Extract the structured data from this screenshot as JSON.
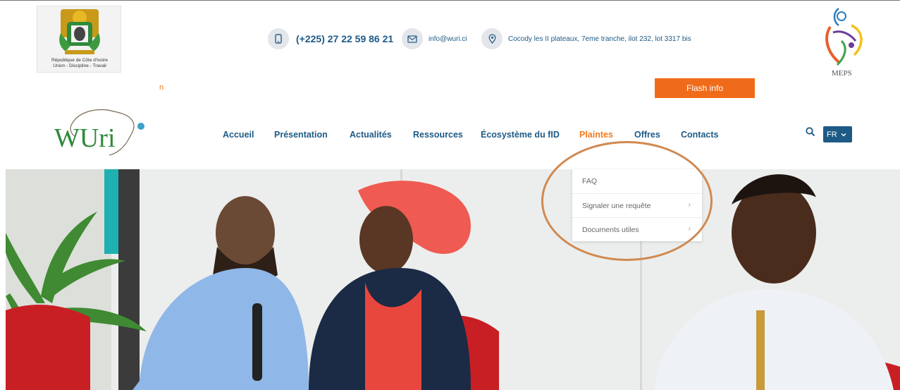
{
  "header": {
    "arms_caption_line1": "République de Côte d'Ivoire",
    "arms_caption_line2": "Union - Discipline - Travail",
    "phone": "(+225) 27 22 59 86 21",
    "email": "info@wuri.ci",
    "address": "Cocody les II plateaux, 7eme tranche, ilot 232, lot 3317 bis",
    "meps_label": "MEPS",
    "ticker_fragment": "n",
    "flash_label": "Flash info"
  },
  "logo": {
    "text": "WUri"
  },
  "nav": {
    "items": [
      {
        "label": "Accueil"
      },
      {
        "label": "Présentation"
      },
      {
        "label": "Actualités"
      },
      {
        "label": "Ressources"
      },
      {
        "label": "Écosystème du fID"
      },
      {
        "label": "Plaintes",
        "active": true
      },
      {
        "label": "Offres"
      },
      {
        "label": "Contacts"
      }
    ],
    "language": "FR"
  },
  "dropdown": {
    "items": [
      {
        "label": "FAQ"
      },
      {
        "label": "Signaler une requête",
        "chevron": "›"
      },
      {
        "label": "Documents utiles",
        "chevron": "›"
      }
    ]
  },
  "colors": {
    "brand_blue": "#1e5a86",
    "accent_orange": "#f07a1f",
    "flash_orange": "#f06b19",
    "highlight_ring": "#d08a52"
  },
  "icons": [
    "phone-icon",
    "email-icon",
    "location-icon",
    "search-icon",
    "chevron-down-icon",
    "chevron-right-icon"
  ]
}
